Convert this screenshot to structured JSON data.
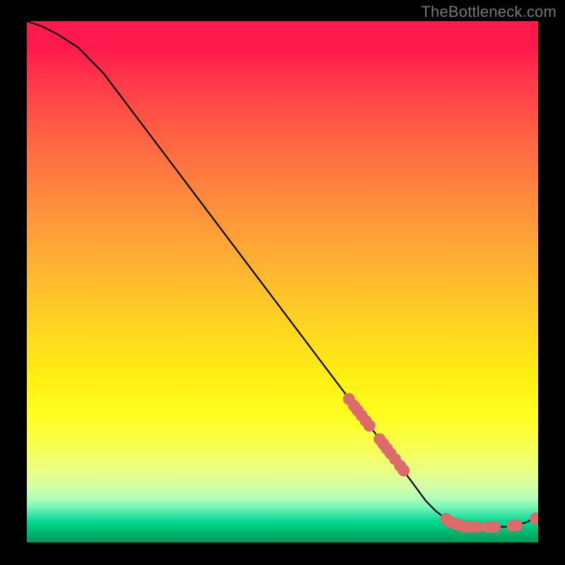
{
  "attribution": "TheBottleneck.com",
  "chart_data": {
    "type": "line",
    "title": "",
    "xlabel": "",
    "ylabel": "",
    "xlim": [
      0,
      100
    ],
    "ylim": [
      0,
      100
    ],
    "curve": {
      "x": [
        0,
        3,
        6,
        10,
        15,
        20,
        30,
        40,
        50,
        60,
        65,
        70,
        75,
        78,
        80,
        82,
        84,
        86,
        88,
        90,
        92,
        94,
        96,
        98,
        100
      ],
      "y": [
        100,
        99,
        97.5,
        95,
        90,
        83.5,
        70.5,
        57.5,
        44.5,
        31.5,
        25,
        18.5,
        12,
        8,
        6,
        4.5,
        3.5,
        3,
        3,
        3,
        3,
        3,
        3.3,
        4,
        5.2
      ]
    },
    "points": {
      "color": "#dd6b6b",
      "x": [
        63,
        64,
        64.7,
        65.5,
        66.3,
        67,
        69,
        69.7,
        70.4,
        71.1,
        72,
        73,
        73.7,
        82,
        83,
        84,
        84.8,
        85.5,
        86.2,
        87,
        88,
        90,
        90.8,
        91.5,
        95,
        95.8,
        99.5
      ],
      "y": [
        27.5,
        26.2,
        25.3,
        24.3,
        23.3,
        22.4,
        19.8,
        18.9,
        18,
        17.1,
        16,
        14.7,
        13.8,
        4.5,
        3.9,
        3.5,
        3.3,
        3.1,
        3,
        3,
        3,
        3,
        3,
        3,
        3.2,
        3.3,
        4.6
      ]
    }
  }
}
